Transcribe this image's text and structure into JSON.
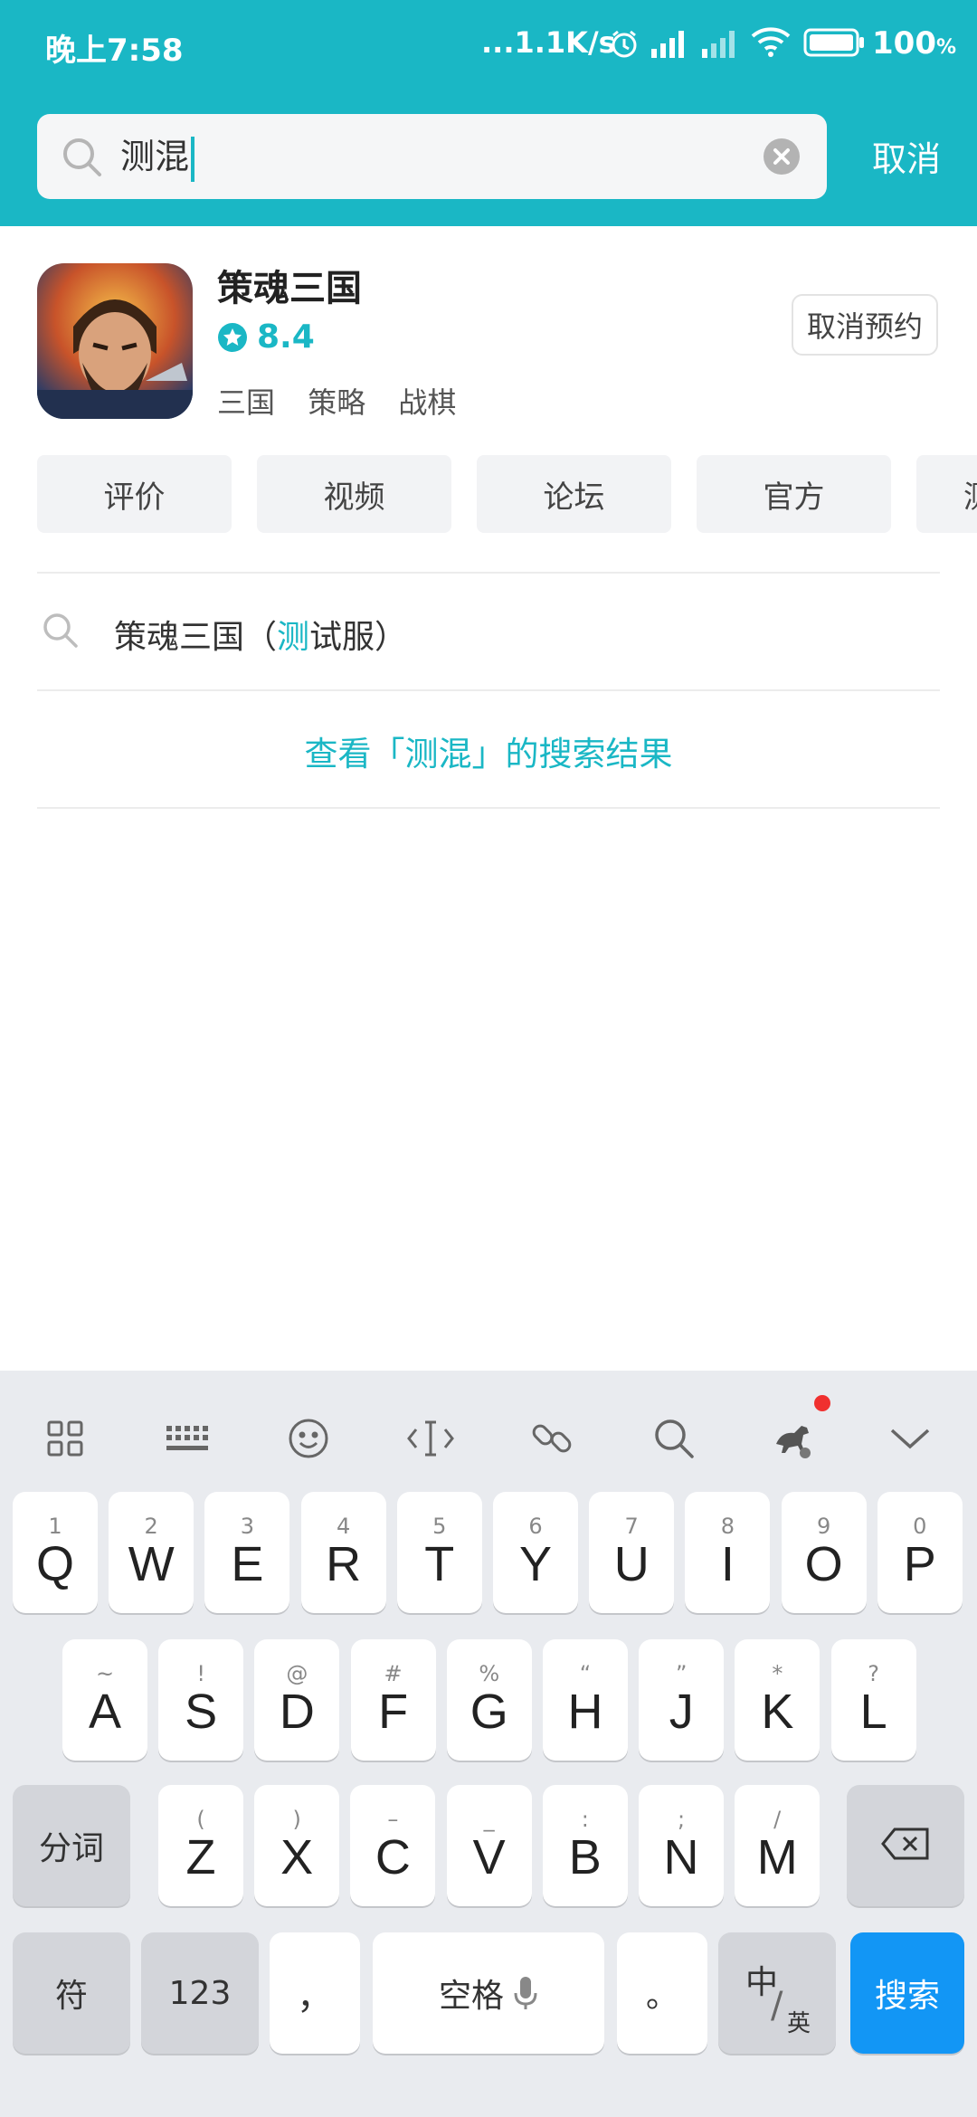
{
  "status_bar": {
    "time": "晚上7:58",
    "net_speed": "...1.1K/s",
    "battery": "100",
    "battery_unit": "%"
  },
  "search": {
    "query": "测混",
    "cancel_label": "取消"
  },
  "game": {
    "title": "策魂三国",
    "rating": "8.4",
    "tags": [
      "三国",
      "策略",
      "战棋"
    ],
    "reserve_button": "取消预约"
  },
  "tabs": [
    "评价",
    "视频",
    "论坛",
    "官方",
    "测"
  ],
  "suggestion": {
    "prefix": "策魂三国（",
    "highlight": "测",
    "suffix": "试服）"
  },
  "view_results_label": "查看「测混」的搜索结果",
  "keyboard": {
    "row1": [
      {
        "num": "1",
        "key": "Q"
      },
      {
        "num": "2",
        "key": "W"
      },
      {
        "num": "3",
        "key": "E"
      },
      {
        "num": "4",
        "key": "R"
      },
      {
        "num": "5",
        "key": "T"
      },
      {
        "num": "6",
        "key": "Y"
      },
      {
        "num": "7",
        "key": "U"
      },
      {
        "num": "8",
        "key": "I"
      },
      {
        "num": "9",
        "key": "O"
      },
      {
        "num": "0",
        "key": "P"
      }
    ],
    "row2": [
      {
        "sym": "~",
        "key": "A"
      },
      {
        "sym": "!",
        "key": "S"
      },
      {
        "sym": "@",
        "key": "D"
      },
      {
        "sym": "#",
        "key": "F"
      },
      {
        "sym": "%",
        "key": "G"
      },
      {
        "sym": "“",
        "key": "H"
      },
      {
        "sym": "”",
        "key": "J"
      },
      {
        "sym": "*",
        "key": "K"
      },
      {
        "sym": "?",
        "key": "L"
      }
    ],
    "row3": [
      {
        "sym": "(",
        "key": "Z"
      },
      {
        "sym": ")",
        "key": "X"
      },
      {
        "sym": "–",
        "key": "C"
      },
      {
        "sym": "_",
        "key": "V"
      },
      {
        "sym": ":",
        "key": "B"
      },
      {
        "sym": ";",
        "key": "N"
      },
      {
        "sym": "/",
        "key": "M"
      }
    ],
    "segment_label": "分词",
    "symbols_label": "符",
    "numbers_label": "123",
    "comma_label": "，",
    "space_label": "空格",
    "period_label": "。",
    "lang_main": "中",
    "lang_sub": "英",
    "search_label": "搜索"
  },
  "colors": {
    "accent": "#1ab7c5",
    "search_key": "#1296f5",
    "notification_dot": "#f0302f"
  }
}
